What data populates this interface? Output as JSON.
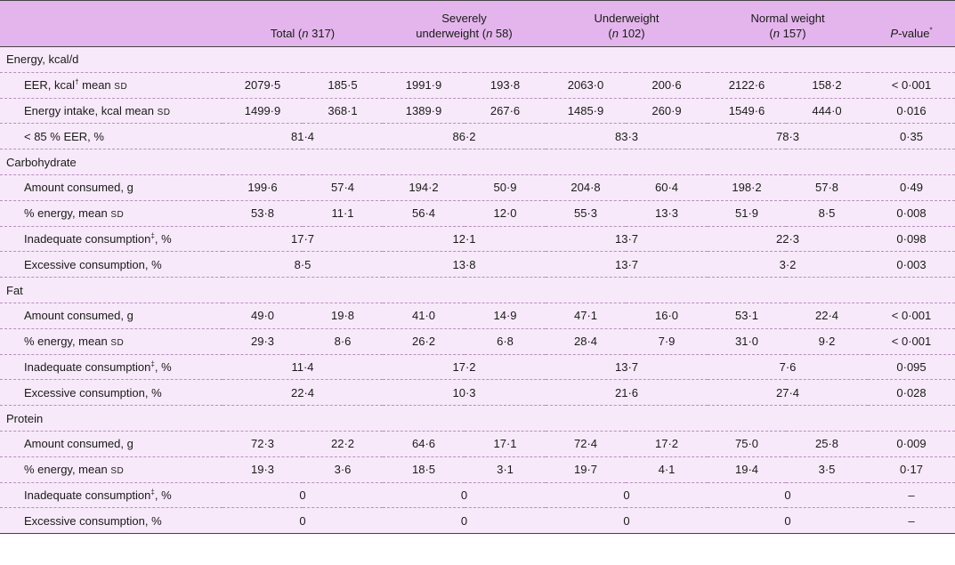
{
  "headers": {
    "total": {
      "a": "Total (",
      "n": "n",
      "b": " 317)"
    },
    "severe": {
      "l1": "Severely",
      "a": "underweight (",
      "n": "n",
      "b": " 58)"
    },
    "under": {
      "l1": "Underweight",
      "a": "(",
      "n": "n",
      "b": " 102)"
    },
    "normal": {
      "l1": "Normal weight",
      "a": "(",
      "n": "n",
      "b": " 157)"
    },
    "p": {
      "p": "P",
      "rest": "-value",
      "sup": "*"
    }
  },
  "rows": [
    {
      "type": "section",
      "label": "Energy, kcal/d"
    },
    {
      "type": "pair",
      "label": "EER, kcal",
      "sup": "†",
      "suffix": " mean ",
      "sd": "sd",
      "v": [
        "2079·5",
        "185·5",
        "1991·9",
        "193·8",
        "2063·0",
        "200·6",
        "2122·6",
        "158·2"
      ],
      "p": "< 0·001"
    },
    {
      "type": "pair",
      "label": "Energy intake, kcal mean ",
      "sd": "sd",
      "v": [
        "1499·9",
        "368·1",
        "1389·9",
        "267·6",
        "1485·9",
        "260·9",
        "1549·6",
        "444·0"
      ],
      "p": "0·016"
    },
    {
      "type": "single",
      "label": "< 85 % EER, %",
      "v": [
        "81·4",
        "86·2",
        "83·3",
        "78·3"
      ],
      "p": "0·35"
    },
    {
      "type": "section",
      "label": "Carbohydrate"
    },
    {
      "type": "pair",
      "label": "Amount consumed, g",
      "v": [
        "199·6",
        "57·4",
        "194·2",
        "50·9",
        "204·8",
        "60·4",
        "198·2",
        "57·8"
      ],
      "p": "0·49"
    },
    {
      "type": "pair",
      "label": "% energy, mean ",
      "sd": "sd",
      "v": [
        "53·8",
        "11·1",
        "56·4",
        "12·0",
        "55·3",
        "13·3",
        "51·9",
        "8·5"
      ],
      "p": "0·008"
    },
    {
      "type": "single",
      "label": "Inadequate consumption",
      "sup": "‡",
      "suffix": ", %",
      "v": [
        "17·7",
        "12·1",
        "13·7",
        "22·3"
      ],
      "p": "0·098"
    },
    {
      "type": "single",
      "label": "Excessive consumption, %",
      "v": [
        "8·5",
        "13·8",
        "13·7",
        "3·2"
      ],
      "p": "0·003"
    },
    {
      "type": "section",
      "label": "Fat"
    },
    {
      "type": "pair",
      "label": "Amount consumed, g",
      "v": [
        "49·0",
        "19·8",
        "41·0",
        "14·9",
        "47·1",
        "16·0",
        "53·1",
        "22·4"
      ],
      "p": "< 0·001"
    },
    {
      "type": "pair",
      "label": "% energy, mean ",
      "sd": "sd",
      "v": [
        "29·3",
        "8·6",
        "26·2",
        "6·8",
        "28·4",
        "7·9",
        "31·0",
        "9·2"
      ],
      "p": "< 0·001"
    },
    {
      "type": "single",
      "label": "Inadequate consumption",
      "sup": "‡",
      "suffix": ", %",
      "v": [
        "11·4",
        "17·2",
        "13·7",
        "7·6"
      ],
      "p": "0·095"
    },
    {
      "type": "single",
      "label": "Excessive consumption, %",
      "v": [
        "22·4",
        "10·3",
        "21·6",
        "27·4"
      ],
      "p": "0·028"
    },
    {
      "type": "section",
      "label": "Protein"
    },
    {
      "type": "pair",
      "label": "Amount consumed, g",
      "v": [
        "72·3",
        "22·2",
        "64·6",
        "17·1",
        "72·4",
        "17·2",
        "75·0",
        "25·8"
      ],
      "p": "0·009"
    },
    {
      "type": "pair",
      "label": "% energy, mean ",
      "sd": "sd",
      "v": [
        "19·3",
        "3·6",
        "18·5",
        "3·1",
        "19·7",
        "4·1",
        "19·4",
        "3·5"
      ],
      "p": "0·17"
    },
    {
      "type": "single",
      "label": "Inadequate consumption",
      "sup": "‡",
      "suffix": ", %",
      "v": [
        "0",
        "0",
        "0",
        "0"
      ],
      "p": "–"
    },
    {
      "type": "single",
      "label": "Excessive consumption, %",
      "v": [
        "0",
        "0",
        "0",
        "0"
      ],
      "p": "–"
    }
  ]
}
